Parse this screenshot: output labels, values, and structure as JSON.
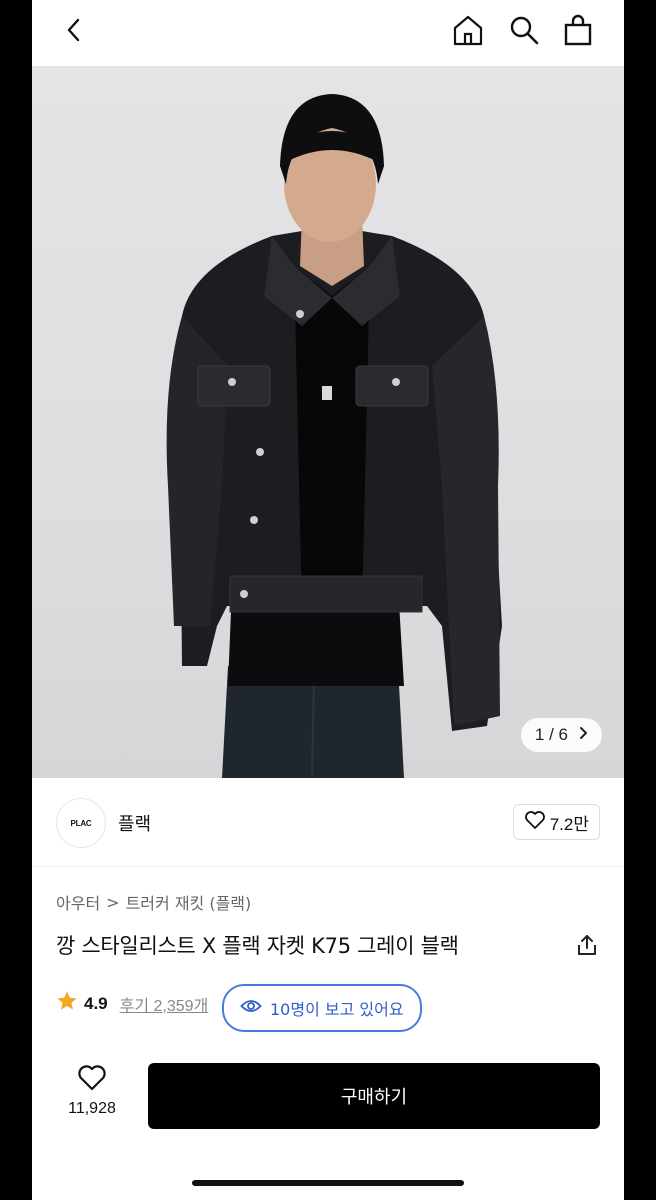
{
  "header": {
    "back_icon": "chevron-left-icon",
    "home_icon": "home-icon",
    "search_icon": "search-icon",
    "bag_icon": "shopping-bag-icon"
  },
  "gallery": {
    "pager": "1 / 6",
    "pager_icon": "chevron-right-icon"
  },
  "brand": {
    "logo_text": "PLAC",
    "name": "플랙",
    "likes": "7.2만"
  },
  "breadcrumb": {
    "parent": "아우터",
    "separator": ">",
    "current": "트러커 재킷 (플랙)"
  },
  "product": {
    "title": "깡 스타일리스트 X 플랙 자켓 K75 그레이 블랙",
    "rating": "4.9",
    "reviews": "후기 2,359개",
    "viewers": "10명이 보고 있어요"
  },
  "bottom": {
    "wish_count": "11,928",
    "buy_label": "구매하기"
  },
  "colors": {
    "accent_blue": "#4a7bdc",
    "star": "#f5a623",
    "buy_bg": "#000000"
  }
}
